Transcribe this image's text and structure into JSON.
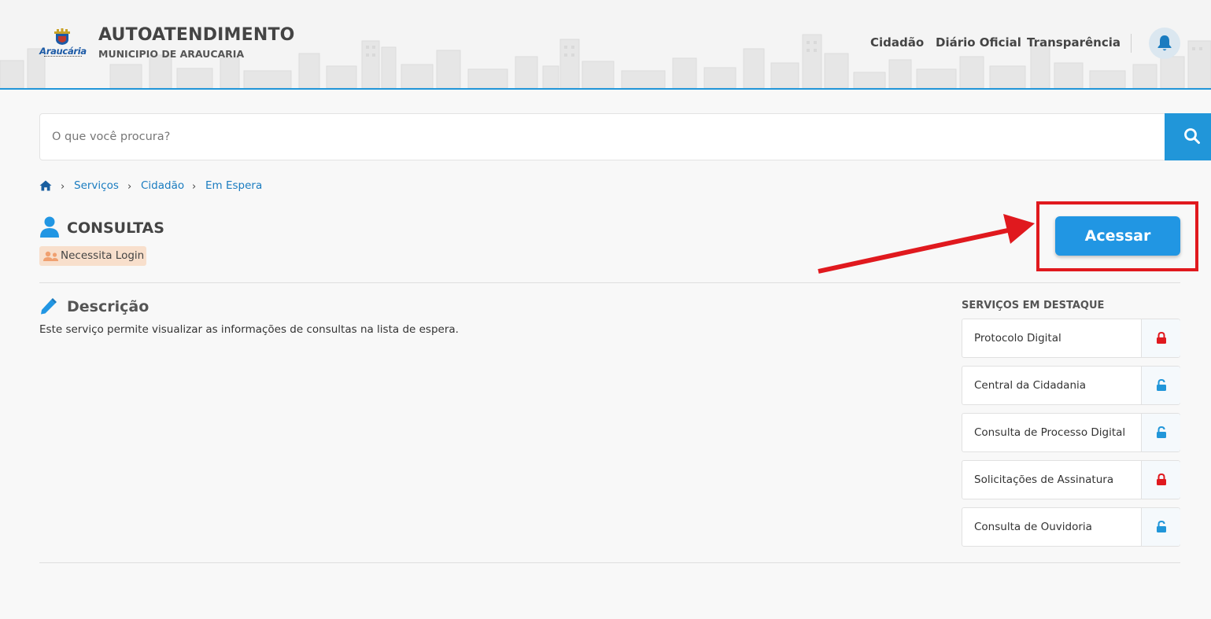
{
  "header": {
    "logo_text": "Araucária",
    "title": "AUTOATENDIMENTO",
    "subtitle": "MUNICIPIO DE ARAUCARIA",
    "nav": [
      "Cidadão",
      "Diário Oficial",
      "Transparência"
    ],
    "accent_color": "#2196d9"
  },
  "search": {
    "placeholder": "O que você procura?",
    "value": ""
  },
  "breadcrumb": [
    "Serviços",
    "Cidadão",
    "Em Espera"
  ],
  "service": {
    "title": "CONSULTAS",
    "badge": "Necessita Login",
    "access_label": "Acessar"
  },
  "description": {
    "title": "Descrição",
    "text": "Este serviço permite visualizar as informações de consultas na lista de espera."
  },
  "featured": {
    "title": "SERVIÇOS EM DESTAQUE",
    "items": [
      {
        "label": "Protocolo Digital",
        "icon": "lock-closed-icon",
        "color": "#e0191e"
      },
      {
        "label": "Central da Cidadania",
        "icon": "lock-open-icon",
        "color": "#2196d9"
      },
      {
        "label": "Consulta de Processo Digital",
        "icon": "lock-open-icon",
        "color": "#2196d9"
      },
      {
        "label": "Solicitações de Assinatura",
        "icon": "lock-closed-icon",
        "color": "#e0191e"
      },
      {
        "label": "Consulta de Ouvidoria",
        "icon": "lock-open-icon",
        "color": "#2196d9"
      }
    ]
  }
}
